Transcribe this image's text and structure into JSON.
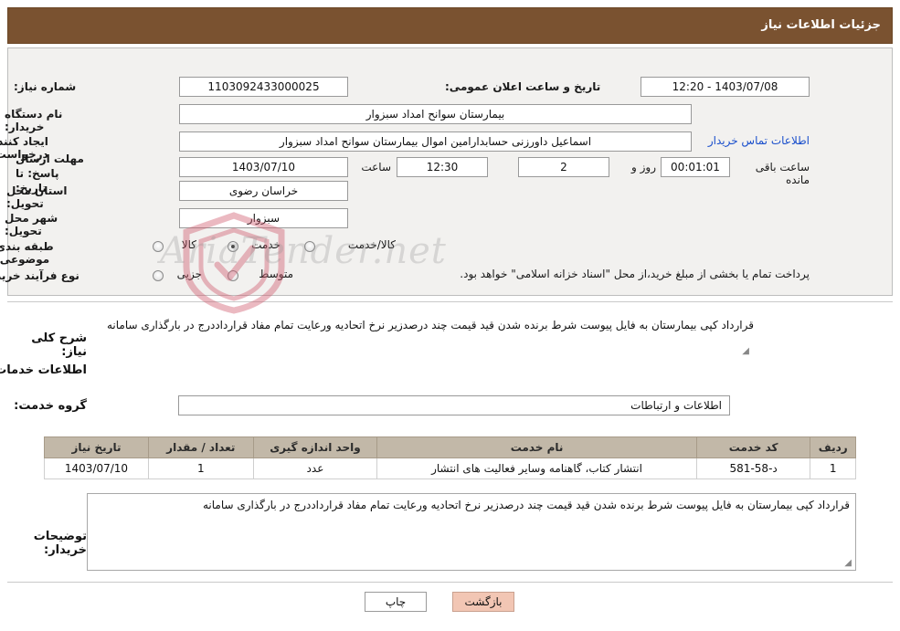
{
  "header": {
    "title": "جزئیات اطلاعات نیاز"
  },
  "form": {
    "need_number_label": "شماره نیاز:",
    "need_number_value": "1103092433000025",
    "announce_datetime_label": "تاریخ و ساعت اعلان عمومی:",
    "announce_datetime_value": "1403/07/08 - 12:20",
    "buyer_org_label": "نام دستگاه خریدار:",
    "buyer_org_value": "بیمارستان سوانح امداد سبزوار",
    "requester_label": "ایجاد کننده درخواست:",
    "requester_value": "اسماعیل داورزنی حسابدارامین اموال بیمارستان سوانح امداد سبزوار",
    "contact_link": "اطلاعات تماس خریدار",
    "deadline_label": "مهلت ارسال پاسخ: تا تاریخ:",
    "deadline_date": "1403/07/10",
    "time_label": "ساعت",
    "deadline_time": "12:30",
    "days_value": "2",
    "days_label": "روز و",
    "countdown_value": "00:01:01",
    "countdown_label": "ساعت باقی مانده",
    "province_label": "استان محل تحویل:",
    "province_value": "خراسان رضوی",
    "city_label": "شهر محل تحویل:",
    "city_value": "سبزوار",
    "category_label": "طبقه بندی موضوعی:",
    "category_options": [
      "کالا",
      "خدمت",
      "کالا/خدمت"
    ],
    "category_selected": "خدمت",
    "process_label": "نوع فرآیند خرید :",
    "process_options": [
      "جزیی",
      "متوسط"
    ],
    "process_selected": "",
    "process_note": "پرداخت تمام یا بخشی از مبلغ خرید،از محل \"اسناد خزانه اسلامی\" خواهد بود."
  },
  "description": {
    "general_label": "شرح کلی نیاز:",
    "general_value": "قرارداد کپی بیمارستان  به فایل پیوست شرط برنده شدن قید قیمت چند درصدزیر نرخ اتحادیه ورعایت تمام مفاد قرارداددرج در بارگذاری سامانه",
    "services_title": "اطلاعات خدمات مورد نیاز",
    "service_group_label": "گروه خدمت:",
    "service_group_value": "اطلاعات و ارتباطات"
  },
  "table": {
    "columns": [
      "ردیف",
      "کد خدمت",
      "نام خدمت",
      "واحد اندازه گیری",
      "تعداد / مقدار",
      "تاریخ نیاز"
    ],
    "rows": [
      {
        "row": "1",
        "code": "د-58-581",
        "name": "انتشار کتاب، گاهنامه وسایر فعالیت های انتشار",
        "unit": "عدد",
        "qty": "1",
        "date": "1403/07/10"
      }
    ]
  },
  "buyer_notes": {
    "label": "توضیحات خریدار:",
    "value": "قرارداد کپی بیمارستان  به فایل پیوست شرط برنده شدن قید قیمت چند درصدزیر نرخ اتحادیه ورعایت تمام مفاد قرارداددرج در بارگذاری سامانه"
  },
  "footer": {
    "print_label": "چاپ",
    "back_label": "بازگشت"
  },
  "watermark": {
    "text": "AriaTender.net"
  },
  "colors": {
    "header_bg": "#7a5230",
    "panel_bg": "#f2f1ef",
    "table_header_bg": "#c2b8a8",
    "link": "#1a4fcc",
    "back_button": "#f2c6b4"
  }
}
